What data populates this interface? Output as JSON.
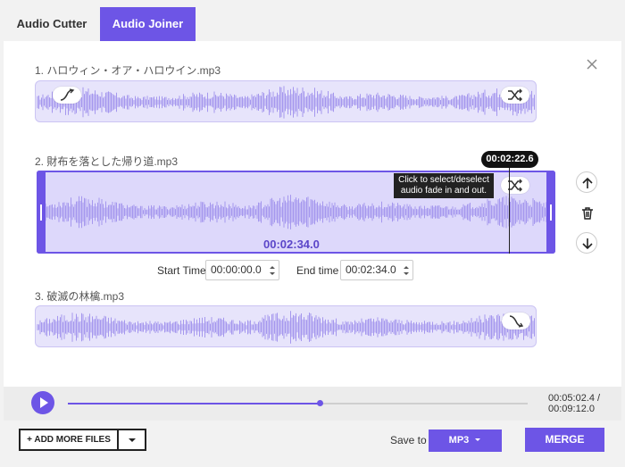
{
  "tabs": [
    {
      "label": "Audio Cutter",
      "active": false
    },
    {
      "label": "Audio Joiner",
      "active": true
    }
  ],
  "tracks": [
    {
      "label": "1. ハロウィン・オア・ハロウイン.mp3",
      "fade_icon": "fade-in-icon",
      "shuffle_icon": "shuffle-icon"
    },
    {
      "label": "2. 財布を落とした帰り道.mp3",
      "duration": "00:02:34.0",
      "playhead_time": "00:02:22.6",
      "shuffle_icon": "shuffle-icon"
    },
    {
      "label": "3. 破滅の林檎.mp3",
      "fade_icon": "fade-out-icon"
    }
  ],
  "tooltip": {
    "line1": "Click to select/deselect",
    "line2": "audio fade in and out."
  },
  "time_range": {
    "start_label": "Start Time",
    "start_value": "00:00:00.0",
    "end_label": "End time",
    "end_value": "00:02:34.0"
  },
  "side_controls": [
    "arrow-up-icon",
    "trash-icon",
    "arrow-down-icon"
  ],
  "player": {
    "current_time": "00:05:02.4 /",
    "total_time": "00:09:12.0",
    "progress": 0.548
  },
  "footer": {
    "add_files_label": "+ ADD MORE FILES",
    "save_to_label": "Save to",
    "format_label": "MP3",
    "merge_label": "MERGE"
  },
  "colors": {
    "accent": "#6d55e6",
    "wave": "#a597ee",
    "track_bg": "#e7e4fb"
  }
}
